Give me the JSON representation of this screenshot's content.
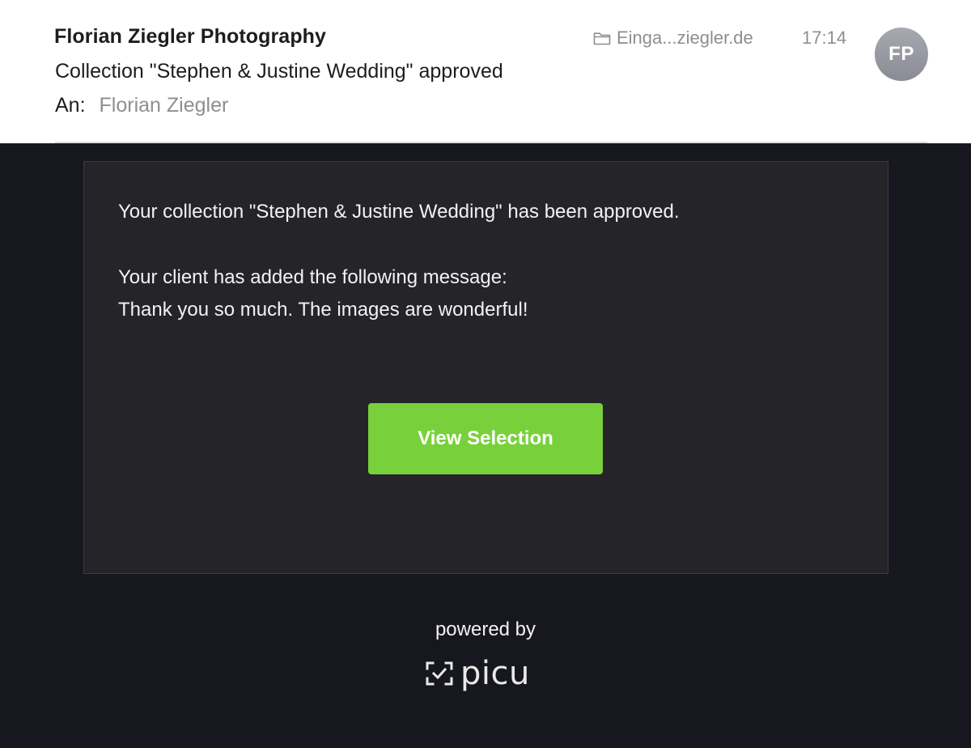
{
  "header": {
    "sender": "Florian Ziegler Photography",
    "subject": "Collection \"Stephen & Justine Wedding\" approved",
    "recipient_label": "An:",
    "recipient": "Florian Ziegler",
    "mailbox": "Einga...ziegler.de",
    "time": "17:14",
    "avatar_initials": "FP",
    "icons": {
      "mailbox": "folder-icon"
    }
  },
  "body": {
    "approved_text": "Your collection \"Stephen & Justine Wedding\" has been approved.",
    "client_intro": "Your client has added the following message:",
    "client_message": "Thank you so much. The images are wonderful!",
    "button_label": "View Selection",
    "powered_by": "powered by",
    "logo_text": "picu",
    "icons": {
      "logo_mark": "picu-checkbox-logo-icon"
    }
  },
  "colors": {
    "background": "#17171f",
    "card": "#252529",
    "button": "#78d13b",
    "muted_text": "#8e8e93"
  }
}
